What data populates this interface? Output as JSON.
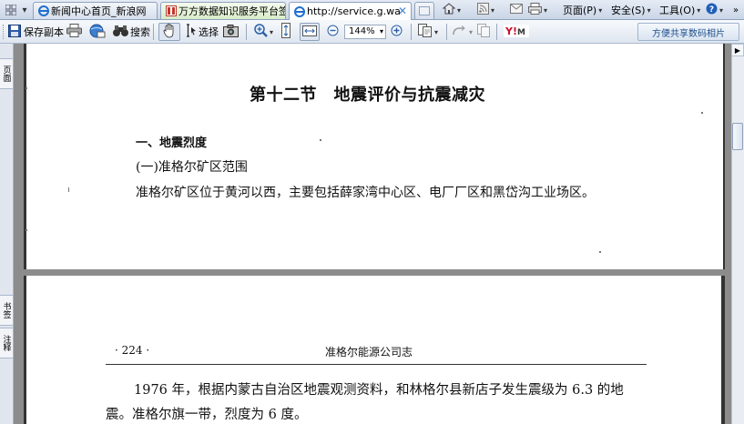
{
  "tabs": [
    {
      "label": "新闻中心首页_新浪网",
      "icon": "ie-icon",
      "active": false
    },
    {
      "label": "万方数据知识服务平台签…",
      "icon": "page-icon",
      "active": false
    },
    {
      "label": "http://service.g.wanf…",
      "icon": "ie-icon",
      "active": true
    }
  ],
  "commands": {
    "page": "页面(P)",
    "safety": "安全(S)",
    "tools": "工具(O)"
  },
  "toolbar": {
    "save_copy": "保存副本",
    "search": "搜索",
    "select": "选择",
    "zoom": "144%",
    "share": "方便共享数码相片"
  },
  "side_tabs": [
    "页面",
    "书签",
    "注释"
  ],
  "page1": {
    "section_title": "第十二节　地震评价与抗震减灾",
    "heading1": "一、地震烈度",
    "heading2": "(一)准格尔矿区范围",
    "paragraph": "准格尔矿区位于黄河以西，主要包括薛家湾中心区、电厂厂区和黑岱沟工业场区。"
  },
  "page2": {
    "page_number": "· 224 ·",
    "running_title": "准格尔能源公司志",
    "line1": "1976 年，根据内蒙古自治区地震观测资料，和林格尔县新店子发生震级为 6.3 的地",
    "line2": "震。准格尔旗一带，烈度为 6 度。"
  },
  "colors": {
    "accent": "#4a86c8",
    "viewer_bg": "#8c8c8c"
  }
}
